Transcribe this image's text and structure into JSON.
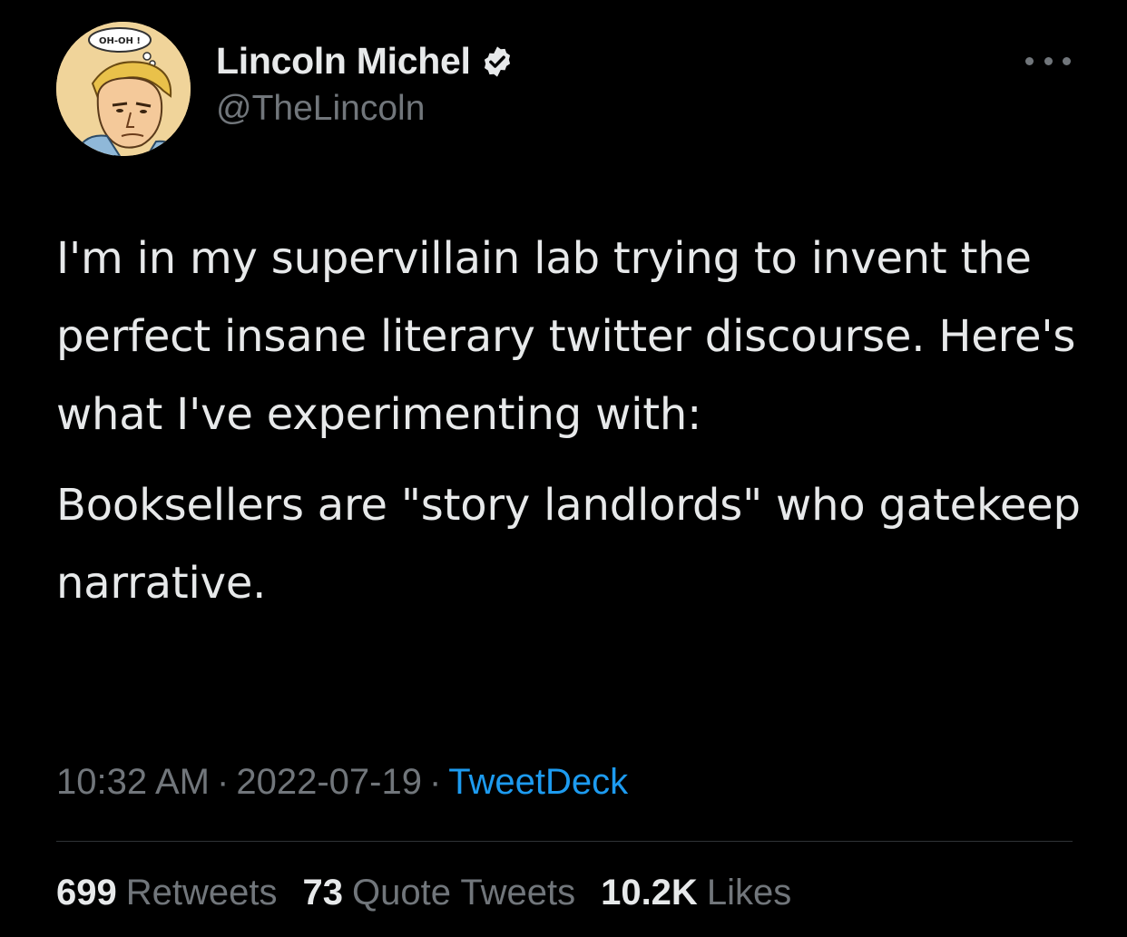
{
  "author": {
    "display_name": "Lincoln Michel",
    "handle": "@TheLincoln",
    "verified": true,
    "avatar_bubble_text": "OH-OH !"
  },
  "tweet": {
    "paragraphs": [
      "I'm in my supervillain lab trying to invent the perfect insane literary twitter discourse. Here's what I've experimenting with:",
      "Booksellers are \"story landlords\" who gatekeep narrative."
    ]
  },
  "meta": {
    "time": "10:32 AM",
    "separator": "·",
    "date": "2022-07-19",
    "source": "TweetDeck"
  },
  "stats": {
    "retweets_count": "699",
    "retweets_label": "Retweets",
    "quotes_count": "73",
    "quotes_label": "Quote Tweets",
    "likes_count": "10.2K",
    "likes_label": "Likes"
  },
  "icons": {
    "more": "more-horizontal-icon",
    "verified": "verified-badge-icon"
  },
  "colors": {
    "background": "#000000",
    "text": "#e7e9ea",
    "secondary": "#71767b",
    "accent": "#1d9bf0",
    "divider": "#2f3336"
  }
}
